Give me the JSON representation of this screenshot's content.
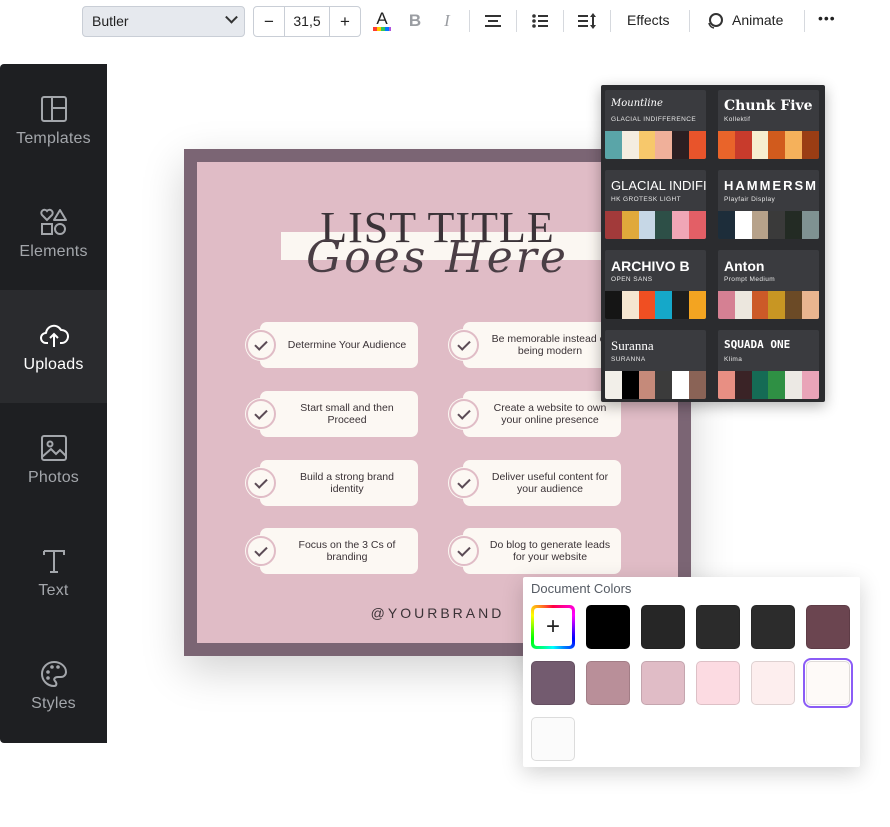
{
  "toolbar": {
    "font_name": "Butler",
    "font_size": "31,5",
    "minus": "−",
    "plus": "+",
    "effects_label": "Effects",
    "animate_label": "Animate",
    "more": "•••"
  },
  "sidebar": {
    "items": [
      {
        "label": "Templates",
        "icon": "templates-icon"
      },
      {
        "label": "Elements",
        "icon": "elements-icon"
      },
      {
        "label": "Uploads",
        "icon": "uploads-icon",
        "active": true
      },
      {
        "label": "Photos",
        "icon": "photos-icon"
      },
      {
        "label": "Text",
        "icon": "text-icon"
      },
      {
        "label": "Styles",
        "icon": "styles-icon"
      }
    ]
  },
  "design": {
    "title_main": "LIST TITLE",
    "title_script": "Goes Here",
    "items": [
      "Determine Your Audience",
      "Be memorable instead of being modern",
      "Start small and then Proceed",
      "Create a website to own your online presence",
      "Build a strong brand identity",
      "Deliver useful content for your audience",
      "Focus on the 3 Cs of branding",
      "Do blog to generate leads for your website"
    ],
    "brand": "@YOURBRAND",
    "colors": {
      "frame": "#7b6574",
      "background": "#e0bcc6",
      "card": "#fcf8f3"
    }
  },
  "font_combos": [
    {
      "title": "Mountline",
      "sub": "GLACIAL INDIFFERENCE",
      "swatches": [
        "#5aa5a8",
        "#f4ede0",
        "#f7c86b",
        "#f0b09a",
        "#2b1f22",
        "#e8542b"
      ]
    },
    {
      "title": "Chunk Five",
      "sub": "Kollektif",
      "swatches": [
        "#e9642a",
        "#c83b2c",
        "#f6eecf",
        "#d15b1d",
        "#f5b15b",
        "#9a3d14"
      ]
    },
    {
      "title": "GLACIAL INDIFI",
      "sub": "HK GROTESK LIGHT",
      "swatches": [
        "#a23a3a",
        "#e0a93b",
        "#c6d7e6",
        "#2d4f47",
        "#f0a6b6",
        "#e35f66"
      ]
    },
    {
      "title": "HAMMERSM",
      "sub": "Playfair Display",
      "swatches": [
        "#1d2d3a",
        "#ffffff",
        "#b7a28a",
        "#3a3a3a",
        "#232b24",
        "#7f9292"
      ]
    },
    {
      "title": "ARCHIVO B",
      "sub": "OPEN SANS",
      "swatches": [
        "#151515",
        "#f5e6d0",
        "#f04f22",
        "#15a8c9",
        "#1d1d1d",
        "#f3a421"
      ]
    },
    {
      "title": "Anton",
      "sub": "Prompt Medium",
      "swatches": [
        "#d58093",
        "#ece7de",
        "#cc5a28",
        "#c89623",
        "#6b4a26",
        "#e9b58f"
      ]
    },
    {
      "title": "Suranna",
      "sub": "SURANNA",
      "swatches": [
        "#f2efe9",
        "#000000",
        "#c58a7a",
        "#3b3b3b",
        "#ffffff",
        "#8a6356"
      ]
    },
    {
      "title": "SQUADA ONE",
      "sub": "Klima",
      "swatches": [
        "#e88f83",
        "#3a2326",
        "#156b55",
        "#2f9044",
        "#ece9e4",
        "#e9a4b8"
      ]
    }
  ],
  "document_colors": {
    "header": "Document Colors",
    "add_label": "+",
    "swatches": [
      "#000000",
      "#262626",
      "#2b2b2b",
      "#2c2c2c",
      "#6b4550",
      "#735b6f",
      "#b98f99",
      "#e0bcc6",
      "#fcdbe2",
      "#fdeeee",
      "#fefaf8",
      "#fbfbfb"
    ],
    "selected_index": 10
  }
}
